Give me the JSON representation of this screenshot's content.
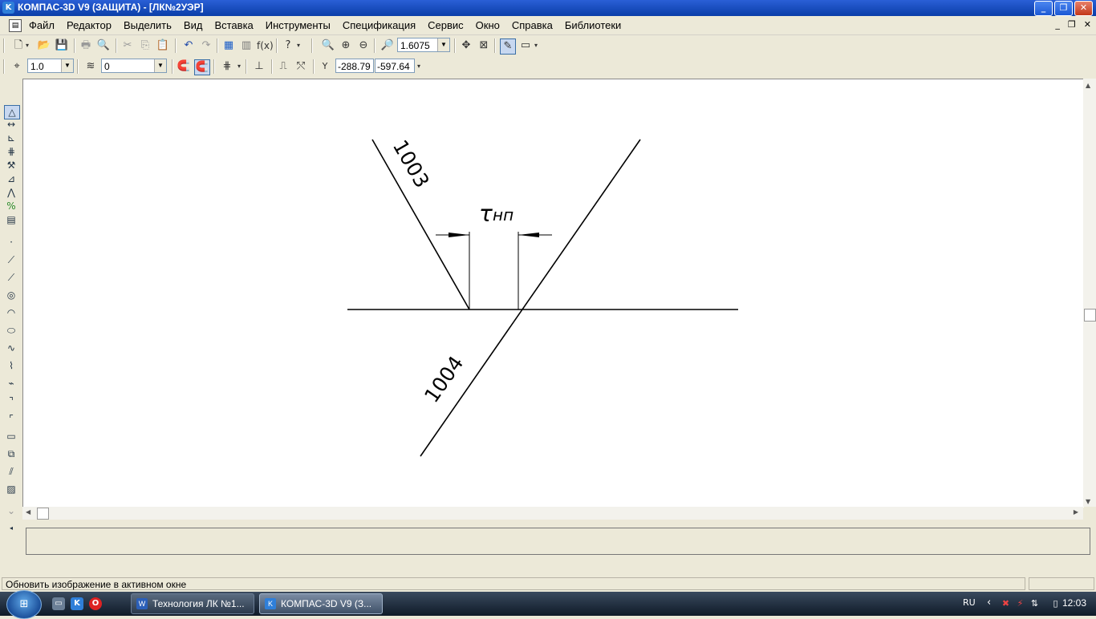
{
  "window": {
    "title": "КОМПАС-3D V9 (ЗАЩИТА) - [ЛК№2УЭР]",
    "app_icon": "kompas-icon"
  },
  "menu": {
    "items": [
      "Файл",
      "Редактор",
      "Выделить",
      "Вид",
      "Вставка",
      "Инструменты",
      "Спецификация",
      "Сервис",
      "Окно",
      "Справка",
      "Библиотеки"
    ]
  },
  "toolbar": {
    "zoom_value": "1.6075",
    "step_value": "1.0",
    "layer_value": "0",
    "coord_x": "-288.79",
    "coord_y": "-597.64"
  },
  "drawing": {
    "label_upper_line": "1003",
    "label_lower_line": "1004",
    "dimension_symbol": "τ",
    "dimension_subscript": "нп",
    "stroke_color": "#000000"
  },
  "status": {
    "text": "Обновить изображение в активном окне"
  },
  "taskbar": {
    "tasks": [
      {
        "label": "Технология ЛК №1...",
        "icon": "word-icon"
      },
      {
        "label": "КОМПАС-3D V9 (З...",
        "icon": "kompas-icon"
      }
    ],
    "lang": "RU",
    "clock": "12:03"
  }
}
